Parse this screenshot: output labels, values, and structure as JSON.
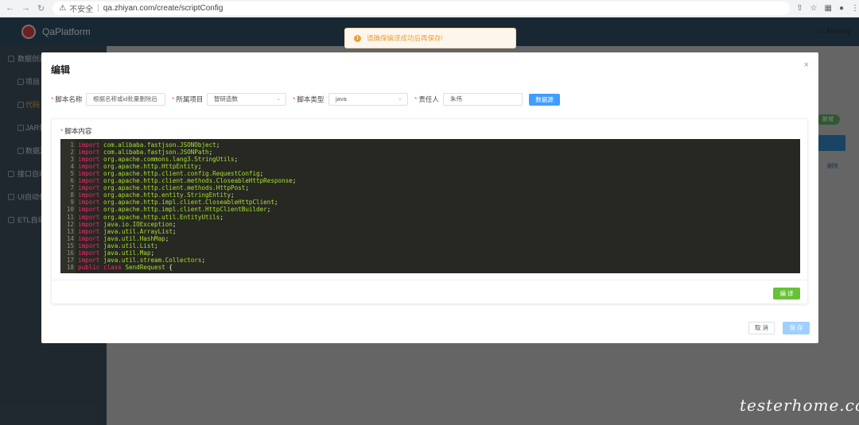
{
  "browser": {
    "unsafe_label": "不安全",
    "url": "qa.zhiyan.com/create/scriptConfig"
  },
  "app": {
    "brand": "QaPlatform",
    "user": "Missing"
  },
  "sidebar": {
    "items": [
      {
        "label": "数据创造"
      },
      {
        "label": "项目"
      },
      {
        "label": "代码"
      },
      {
        "label": "JAR包"
      },
      {
        "label": "数据源"
      },
      {
        "label": "接口自动"
      },
      {
        "label": "UI自动化"
      },
      {
        "label": "ETL自动"
      }
    ]
  },
  "background": {
    "badge": "新增",
    "delete_link": "删除"
  },
  "toast": {
    "icon": "!",
    "message": "请确保编译成功后再保存!"
  },
  "dialog": {
    "title": "编辑",
    "close": "×",
    "form": {
      "name_label": "脚本名称",
      "name_placeholder": "根据名称或id批量删除后",
      "project_label": "所属项目",
      "project_value": "智研造数",
      "type_label": "脚本类型",
      "type_value": "java",
      "owner_label": "责任人",
      "owner_value": "朱伟",
      "datasource_button": "数据源"
    },
    "content_label": "脚本内容",
    "code_lines": [
      {
        "n": "1",
        "kw": "import",
        "rest": "com.alibaba.fastjson.JSONObject",
        "end": ";"
      },
      {
        "n": "2",
        "kw": "import",
        "rest": "com.alibaba.fastjson.JSONPath",
        "end": ";"
      },
      {
        "n": "3",
        "kw": "import",
        "rest": "org.apache.commons.lang3.StringUtils",
        "end": ";"
      },
      {
        "n": "4",
        "kw": "import",
        "rest": "org.apache.http.HttpEntity",
        "end": ";"
      },
      {
        "n": "5",
        "kw": "import",
        "rest": "org.apache.http.client.config.RequestConfig",
        "end": ";"
      },
      {
        "n": "6",
        "kw": "import",
        "rest": "org.apache.http.client.methods.CloseableHttpResponse",
        "end": ";"
      },
      {
        "n": "7",
        "kw": "import",
        "rest": "org.apache.http.client.methods.HttpPost",
        "end": ";"
      },
      {
        "n": "8",
        "kw": "import",
        "rest": "org.apache.http.entity.StringEntity",
        "end": ";"
      },
      {
        "n": "9",
        "kw": "import",
        "rest": "org.apache.http.impl.client.CloseableHttpClient",
        "end": ";"
      },
      {
        "n": "10",
        "kw": "import",
        "rest": "org.apache.http.impl.client.HttpClientBuilder",
        "end": ";"
      },
      {
        "n": "11",
        "kw": "import",
        "rest": "org.apache.http.util.EntityUtils",
        "end": ";"
      },
      {
        "n": "12",
        "kw": "import",
        "rest": "java.io.IOException",
        "end": ";"
      },
      {
        "n": "13",
        "kw": "import",
        "rest": "java.util.ArrayList",
        "end": ";"
      },
      {
        "n": "14",
        "kw": "import",
        "rest": "java.util.HashMap",
        "end": ";"
      },
      {
        "n": "15",
        "kw": "import",
        "rest": "java.util.List",
        "end": ";"
      },
      {
        "n": "16",
        "kw": "import",
        "rest": "java.util.Map",
        "end": ";"
      },
      {
        "n": "17",
        "kw": "import",
        "rest": "java.util.stream.Collectors",
        "end": ";"
      },
      {
        "n": "18",
        "kw": "public class",
        "rest": "SendRequest",
        "end": " {"
      }
    ],
    "compile_button": "编 译",
    "cancel_button": "取 消",
    "save_button": "保 存"
  },
  "watermark": "testerhome.com",
  "colors": {
    "primary": "#409eff",
    "success": "#67c23a",
    "warning": "#e6a23c",
    "header": "#2d4a5d",
    "sidebar": "#3b4a56",
    "editor_bg": "#272822"
  }
}
